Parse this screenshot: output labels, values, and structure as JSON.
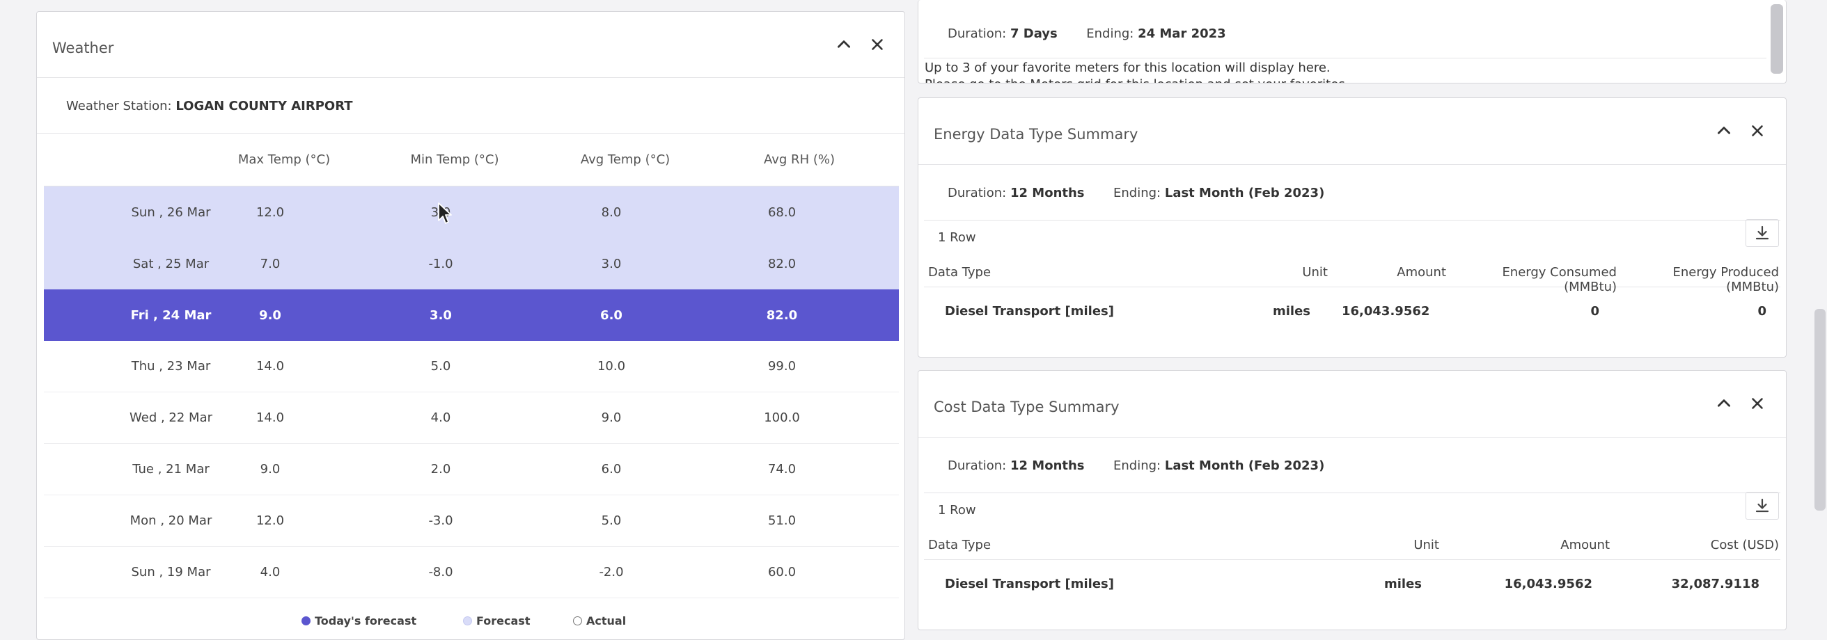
{
  "weather": {
    "title": "Weather",
    "station_label": "Weather Station:",
    "station_name": "LOGAN COUNTY AIRPORT",
    "columns": [
      "Max Temp (°C)",
      "Min Temp (°C)",
      "Avg Temp (°C)",
      "Avg RH (%)"
    ],
    "rows": [
      {
        "date": "Sun , 26 Mar",
        "max": "12.0",
        "min": "3.0",
        "avg": "8.0",
        "rh": "68.0"
      },
      {
        "date": "Sat , 25 Mar",
        "max": "7.0",
        "min": "-1.0",
        "avg": "3.0",
        "rh": "82.0"
      },
      {
        "date": "Fri , 24 Mar",
        "max": "9.0",
        "min": "3.0",
        "avg": "6.0",
        "rh": "82.0"
      },
      {
        "date": "Thu , 23 Mar",
        "max": "14.0",
        "min": "5.0",
        "avg": "10.0",
        "rh": "99.0"
      },
      {
        "date": "Wed , 22 Mar",
        "max": "14.0",
        "min": "4.0",
        "avg": "9.0",
        "rh": "100.0"
      },
      {
        "date": "Tue , 21 Mar",
        "max": "9.0",
        "min": "2.0",
        "avg": "6.0",
        "rh": "74.0"
      },
      {
        "date": "Mon , 20 Mar",
        "max": "12.0",
        "min": "-3.0",
        "avg": "5.0",
        "rh": "51.0"
      },
      {
        "date": "Sun , 19 Mar",
        "max": "4.0",
        "min": "-8.0",
        "avg": "-2.0",
        "rh": "60.0"
      }
    ],
    "legend": {
      "today": "Today's forecast",
      "forecast": "Forecast",
      "actual": "Actual"
    },
    "colors": {
      "today": "#5b56cf",
      "forecast": "#d9dcf8"
    }
  },
  "meters": {
    "duration_label": "Duration:",
    "duration_value": "7 Days",
    "ending_label": "Ending:",
    "ending_value": "24 Mar 2023",
    "message_line1": "Up to 3 of your favorite meters for this location will display here.",
    "message_line2": "Please go to the Meters grid for this location and set your favorites."
  },
  "energy": {
    "title": "Energy Data Type Summary",
    "duration_label": "Duration:",
    "duration_value": "12 Months",
    "ending_label": "Ending:",
    "ending_value": "Last Month (Feb 2023)",
    "row_count": "1 Row",
    "columns": [
      "Data Type",
      "Unit",
      "Amount",
      "Energy Consumed (MMBtu)",
      "Energy Produced (MMBtu)"
    ],
    "rows": [
      {
        "type": "Diesel Transport [miles]",
        "unit": "miles",
        "amount": "16,043.9562",
        "consumed": "0",
        "produced": "0"
      }
    ]
  },
  "cost": {
    "title": "Cost Data Type Summary",
    "duration_label": "Duration:",
    "duration_value": "12 Months",
    "ending_label": "Ending:",
    "ending_value": "Last Month (Feb 2023)",
    "row_count": "1 Row",
    "columns": [
      "Data Type",
      "Unit",
      "Amount",
      "Cost (USD)"
    ],
    "rows": [
      {
        "type": "Diesel Transport [miles]",
        "unit": "miles",
        "amount": "16,043.9562",
        "cost": "32,087.9118"
      }
    ]
  }
}
